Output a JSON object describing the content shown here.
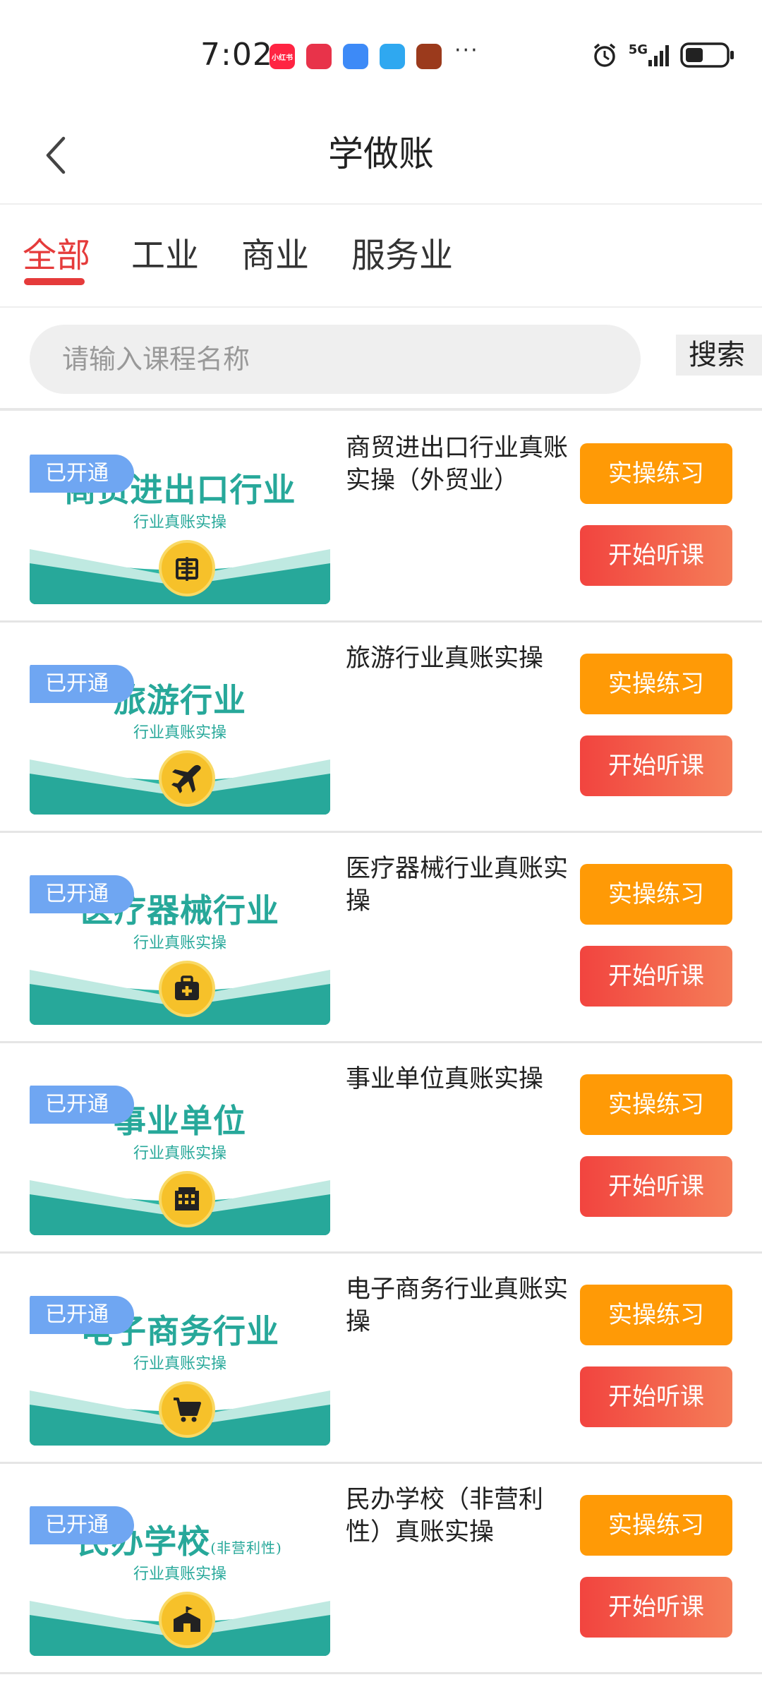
{
  "status_bar": {
    "time": "7:02",
    "network": "5G",
    "app_icons": [
      {
        "name": "xiaohongshu-icon",
        "label": "小红书",
        "color": "#ff2442"
      },
      {
        "name": "huawei-icon",
        "label": "",
        "color": "#e8334a"
      },
      {
        "name": "cloud-icon",
        "label": "",
        "color": "#3d8af7"
      },
      {
        "name": "weather-icon",
        "label": "",
        "color": "#2fa8f0"
      },
      {
        "name": "game-icon",
        "label": "",
        "color": "#9b3a1c"
      }
    ],
    "more": "···"
  },
  "header": {
    "title": "学做账",
    "back_icon": "chevron-left-icon"
  },
  "tabs": [
    {
      "label": "全部",
      "active": true
    },
    {
      "label": "工业",
      "active": false
    },
    {
      "label": "商业",
      "active": false
    },
    {
      "label": "服务业",
      "active": false
    }
  ],
  "search": {
    "placeholder": "请输入课程名称",
    "button_label": "搜索"
  },
  "courses": [
    {
      "banner_title": "商贸进出口行业",
      "banner_title_suffix": "",
      "banner_subtitle": "行业真账实操",
      "badge": "已开通",
      "icon": "customs-icon",
      "name": "商贸进出口行业真账实操（外贸业）",
      "practice_label": "实操练习",
      "listen_label": "开始听课"
    },
    {
      "banner_title": "旅游行业",
      "banner_title_suffix": "",
      "banner_subtitle": "行业真账实操",
      "badge": "已开通",
      "icon": "airplane-icon",
      "name": "旅游行业真账实操",
      "practice_label": "实操练习",
      "listen_label": "开始听课"
    },
    {
      "banner_title": "医疗器械行业",
      "banner_title_suffix": "",
      "banner_subtitle": "行业真账实操",
      "badge": "已开通",
      "icon": "medical-kit-icon",
      "name": "医疗器械行业真账实操",
      "practice_label": "实操练习",
      "listen_label": "开始听课"
    },
    {
      "banner_title": "事业单位",
      "banner_title_suffix": "",
      "banner_subtitle": "行业真账实操",
      "badge": "已开通",
      "icon": "building-icon",
      "name": "事业单位真账实操",
      "practice_label": "实操练习",
      "listen_label": "开始听课"
    },
    {
      "banner_title": "电子商务行业",
      "banner_title_suffix": "",
      "banner_subtitle": "行业真账实操",
      "badge": "已开通",
      "icon": "cart-icon",
      "name": "电子商务行业真账实操",
      "practice_label": "实操练习",
      "listen_label": "开始听课"
    },
    {
      "banner_title": "民办学校",
      "banner_title_suffix": "(非营利性)",
      "banner_subtitle": "行业真账实操",
      "badge": "已开通",
      "icon": "school-icon",
      "name": "民办学校（非营利性）真账实操",
      "practice_label": "实操练习",
      "listen_label": "开始听课"
    }
  ],
  "colors": {
    "accent": "#e53b3b",
    "practice_button": "#ff9a06",
    "listen_button": "#f2443f",
    "banner_teal": "#27a89a",
    "badge_blue": "#6fa6f2",
    "icon_yellow": "#f6c12a"
  }
}
